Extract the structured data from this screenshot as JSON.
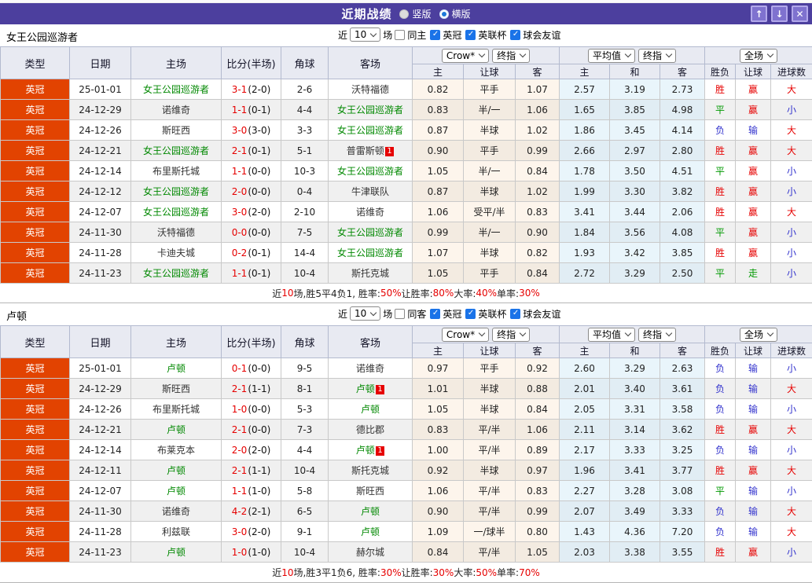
{
  "colors": {
    "titlebar_bg": "#4c3f9e",
    "league_cell_bg": "#e24301",
    "focus_team": "#008800",
    "score_red": "#e60000",
    "result_text": {
      "胜": "red",
      "平": "green",
      "负": "blue",
      "赢": "red",
      "输": "blue",
      "走": "green",
      "大": "red",
      "小": "blue"
    }
  },
  "title_bar": {
    "title": "近期战绩",
    "radio_vertical": "竖版",
    "radio_horizontal": "横版",
    "selected_layout": "横版",
    "buttons": {
      "up": "↑",
      "down": "↓",
      "close": "✕"
    }
  },
  "columns": {
    "main": [
      "类型",
      "日期",
      "主场",
      "比分(半场)",
      "角球",
      "客场"
    ],
    "sub": [
      "主",
      "让球",
      "客",
      "主",
      "和",
      "客",
      "胜负",
      "让球",
      "进球数"
    ]
  },
  "sections": [
    {
      "team": "女王公园巡游者",
      "filter": {
        "near": "近",
        "count": "10",
        "matches": "场",
        "same_label": "同主",
        "same_checked": false,
        "leagues": [
          {
            "label": "英冠",
            "checked": true
          },
          {
            "label": "英联杯",
            "checked": true
          },
          {
            "label": "球会友谊",
            "checked": true
          }
        ]
      },
      "dropdowns": {
        "odds_company": "Crow*",
        "odds_final": "终指",
        "avg": "平均值",
        "avg_final": "终指",
        "scope": "全场"
      },
      "rows": [
        {
          "league": "英冠",
          "date": "25-01-01",
          "home": "女王公园巡游者",
          "home_focus": true,
          "home_red": false,
          "score_ft": "3-1",
          "score_half": "(2-0)",
          "corner": "2-6",
          "away": "沃特福德",
          "away_focus": false,
          "away_red": false,
          "odds_home": "0.82",
          "handicap": "平手",
          "odds_away": "1.07",
          "avg_home": "2.57",
          "avg_draw": "3.19",
          "avg_away": "2.73",
          "result": "胜",
          "handicap_result": "赢",
          "goals": "大"
        },
        {
          "league": "英冠",
          "date": "24-12-29",
          "home": "诺维奇",
          "home_focus": false,
          "home_red": false,
          "score_ft": "1-1",
          "score_half": "(0-1)",
          "corner": "4-4",
          "away": "女王公园巡游者",
          "away_focus": true,
          "away_red": false,
          "odds_home": "0.83",
          "handicap": "半/一",
          "odds_away": "1.06",
          "avg_home": "1.65",
          "avg_draw": "3.85",
          "avg_away": "4.98",
          "result": "平",
          "handicap_result": "赢",
          "goals": "小"
        },
        {
          "league": "英冠",
          "date": "24-12-26",
          "home": "斯旺西",
          "home_focus": false,
          "home_red": false,
          "score_ft": "3-0",
          "score_half": "(3-0)",
          "corner": "3-3",
          "away": "女王公园巡游者",
          "away_focus": true,
          "away_red": false,
          "odds_home": "0.87",
          "handicap": "半球",
          "odds_away": "1.02",
          "avg_home": "1.86",
          "avg_draw": "3.45",
          "avg_away": "4.14",
          "result": "负",
          "handicap_result": "输",
          "goals": "大"
        },
        {
          "league": "英冠",
          "date": "24-12-21",
          "home": "女王公园巡游者",
          "home_focus": true,
          "home_red": false,
          "score_ft": "2-1",
          "score_half": "(0-1)",
          "corner": "5-1",
          "away": "普雷斯顿",
          "away_focus": false,
          "away_red": true,
          "odds_home": "0.90",
          "handicap": "平手",
          "odds_away": "0.99",
          "avg_home": "2.66",
          "avg_draw": "2.97",
          "avg_away": "2.80",
          "result": "胜",
          "handicap_result": "赢",
          "goals": "大"
        },
        {
          "league": "英冠",
          "date": "24-12-14",
          "home": "布里斯托城",
          "home_focus": false,
          "home_red": false,
          "score_ft": "1-1",
          "score_half": "(0-0)",
          "corner": "10-3",
          "away": "女王公园巡游者",
          "away_focus": true,
          "away_red": false,
          "odds_home": "1.05",
          "handicap": "半/一",
          "odds_away": "0.84",
          "avg_home": "1.78",
          "avg_draw": "3.50",
          "avg_away": "4.51",
          "result": "平",
          "handicap_result": "赢",
          "goals": "小"
        },
        {
          "league": "英冠",
          "date": "24-12-12",
          "home": "女王公园巡游者",
          "home_focus": true,
          "home_red": false,
          "score_ft": "2-0",
          "score_half": "(0-0)",
          "corner": "0-4",
          "away": "牛津联队",
          "away_focus": false,
          "away_red": false,
          "odds_home": "0.87",
          "handicap": "半球",
          "odds_away": "1.02",
          "avg_home": "1.99",
          "avg_draw": "3.30",
          "avg_away": "3.82",
          "result": "胜",
          "handicap_result": "赢",
          "goals": "小"
        },
        {
          "league": "英冠",
          "date": "24-12-07",
          "home": "女王公园巡游者",
          "home_focus": true,
          "home_red": false,
          "score_ft": "3-0",
          "score_half": "(2-0)",
          "corner": "2-10",
          "away": "诺维奇",
          "away_focus": false,
          "away_red": false,
          "odds_home": "1.06",
          "handicap": "受平/半",
          "odds_away": "0.83",
          "avg_home": "3.41",
          "avg_draw": "3.44",
          "avg_away": "2.06",
          "result": "胜",
          "handicap_result": "赢",
          "goals": "大"
        },
        {
          "league": "英冠",
          "date": "24-11-30",
          "home": "沃特福德",
          "home_focus": false,
          "home_red": false,
          "score_ft": "0-0",
          "score_half": "(0-0)",
          "corner": "7-5",
          "away": "女王公园巡游者",
          "away_focus": true,
          "away_red": false,
          "odds_home": "0.99",
          "handicap": "半/一",
          "odds_away": "0.90",
          "avg_home": "1.84",
          "avg_draw": "3.56",
          "avg_away": "4.08",
          "result": "平",
          "handicap_result": "赢",
          "goals": "小"
        },
        {
          "league": "英冠",
          "date": "24-11-28",
          "home": "卡迪夫城",
          "home_focus": false,
          "home_red": false,
          "score_ft": "0-2",
          "score_half": "(0-1)",
          "corner": "14-4",
          "away": "女王公园巡游者",
          "away_focus": true,
          "away_red": false,
          "odds_home": "1.07",
          "handicap": "半球",
          "odds_away": "0.82",
          "avg_home": "1.93",
          "avg_draw": "3.42",
          "avg_away": "3.85",
          "result": "胜",
          "handicap_result": "赢",
          "goals": "小"
        },
        {
          "league": "英冠",
          "date": "24-11-23",
          "home": "女王公园巡游者",
          "home_focus": true,
          "home_red": false,
          "score_ft": "1-1",
          "score_half": "(0-1)",
          "corner": "10-4",
          "away": "斯托克城",
          "away_focus": false,
          "away_red": false,
          "odds_home": "1.05",
          "handicap": "平手",
          "odds_away": "0.84",
          "avg_home": "2.72",
          "avg_draw": "3.29",
          "avg_away": "2.50",
          "result": "平",
          "handicap_result": "走",
          "goals": "小"
        }
      ],
      "summary": [
        {
          "text": "近",
          "hl": false
        },
        {
          "text": "10",
          "hl": true
        },
        {
          "text": "场,胜5平4负1, 胜率:",
          "hl": false
        },
        {
          "text": "50%",
          "hl": true
        },
        {
          "text": " 让胜率:",
          "hl": false
        },
        {
          "text": "80%",
          "hl": true
        },
        {
          "text": " 大率:",
          "hl": false
        },
        {
          "text": "40%",
          "hl": true
        },
        {
          "text": " 单率:",
          "hl": false
        },
        {
          "text": "30%",
          "hl": true
        }
      ]
    },
    {
      "team": "卢顿",
      "filter": {
        "near": "近",
        "count": "10",
        "matches": "场",
        "same_label": "同客",
        "same_checked": false,
        "leagues": [
          {
            "label": "英冠",
            "checked": true
          },
          {
            "label": "英联杯",
            "checked": true
          },
          {
            "label": "球会友谊",
            "checked": true
          }
        ]
      },
      "dropdowns": {
        "odds_company": "Crow*",
        "odds_final": "终指",
        "avg": "平均值",
        "avg_final": "终指",
        "scope": "全场"
      },
      "rows": [
        {
          "league": "英冠",
          "date": "25-01-01",
          "home": "卢顿",
          "home_focus": true,
          "home_red": false,
          "score_ft": "0-1",
          "score_half": "(0-0)",
          "corner": "9-5",
          "away": "诺维奇",
          "away_focus": false,
          "away_red": false,
          "odds_home": "0.97",
          "handicap": "平手",
          "odds_away": "0.92",
          "avg_home": "2.60",
          "avg_draw": "3.29",
          "avg_away": "2.63",
          "result": "负",
          "handicap_result": "输",
          "goals": "小"
        },
        {
          "league": "英冠",
          "date": "24-12-29",
          "home": "斯旺西",
          "home_focus": false,
          "home_red": false,
          "score_ft": "2-1",
          "score_half": "(1-1)",
          "corner": "8-1",
          "away": "卢顿",
          "away_focus": true,
          "away_red": true,
          "odds_home": "1.01",
          "handicap": "半球",
          "odds_away": "0.88",
          "avg_home": "2.01",
          "avg_draw": "3.40",
          "avg_away": "3.61",
          "result": "负",
          "handicap_result": "输",
          "goals": "大"
        },
        {
          "league": "英冠",
          "date": "24-12-26",
          "home": "布里斯托城",
          "home_focus": false,
          "home_red": false,
          "score_ft": "1-0",
          "score_half": "(0-0)",
          "corner": "5-3",
          "away": "卢顿",
          "away_focus": true,
          "away_red": false,
          "odds_home": "1.05",
          "handicap": "半球",
          "odds_away": "0.84",
          "avg_home": "2.05",
          "avg_draw": "3.31",
          "avg_away": "3.58",
          "result": "负",
          "handicap_result": "输",
          "goals": "小"
        },
        {
          "league": "英冠",
          "date": "24-12-21",
          "home": "卢顿",
          "home_focus": true,
          "home_red": false,
          "score_ft": "2-1",
          "score_half": "(0-0)",
          "corner": "7-3",
          "away": "德比郡",
          "away_focus": false,
          "away_red": false,
          "odds_home": "0.83",
          "handicap": "平/半",
          "odds_away": "1.06",
          "avg_home": "2.11",
          "avg_draw": "3.14",
          "avg_away": "3.62",
          "result": "胜",
          "handicap_result": "赢",
          "goals": "大"
        },
        {
          "league": "英冠",
          "date": "24-12-14",
          "home": "布莱克本",
          "home_focus": false,
          "home_red": false,
          "score_ft": "2-0",
          "score_half": "(2-0)",
          "corner": "4-4",
          "away": "卢顿",
          "away_focus": true,
          "away_red": true,
          "odds_home": "1.00",
          "handicap": "平/半",
          "odds_away": "0.89",
          "avg_home": "2.17",
          "avg_draw": "3.33",
          "avg_away": "3.25",
          "result": "负",
          "handicap_result": "输",
          "goals": "小"
        },
        {
          "league": "英冠",
          "date": "24-12-11",
          "home": "卢顿",
          "home_focus": true,
          "home_red": false,
          "score_ft": "2-1",
          "score_half": "(1-1)",
          "corner": "10-4",
          "away": "斯托克城",
          "away_focus": false,
          "away_red": false,
          "odds_home": "0.92",
          "handicap": "半球",
          "odds_away": "0.97",
          "avg_home": "1.96",
          "avg_draw": "3.41",
          "avg_away": "3.77",
          "result": "胜",
          "handicap_result": "赢",
          "goals": "大"
        },
        {
          "league": "英冠",
          "date": "24-12-07",
          "home": "卢顿",
          "home_focus": true,
          "home_red": false,
          "score_ft": "1-1",
          "score_half": "(1-0)",
          "corner": "5-8",
          "away": "斯旺西",
          "away_focus": false,
          "away_red": false,
          "odds_home": "1.06",
          "handicap": "平/半",
          "odds_away": "0.83",
          "avg_home": "2.27",
          "avg_draw": "3.28",
          "avg_away": "3.08",
          "result": "平",
          "handicap_result": "输",
          "goals": "小"
        },
        {
          "league": "英冠",
          "date": "24-11-30",
          "home": "诺维奇",
          "home_focus": false,
          "home_red": false,
          "score_ft": "4-2",
          "score_half": "(2-1)",
          "corner": "6-5",
          "away": "卢顿",
          "away_focus": true,
          "away_red": false,
          "odds_home": "0.90",
          "handicap": "平/半",
          "odds_away": "0.99",
          "avg_home": "2.07",
          "avg_draw": "3.49",
          "avg_away": "3.33",
          "result": "负",
          "handicap_result": "输",
          "goals": "大"
        },
        {
          "league": "英冠",
          "date": "24-11-28",
          "home": "利兹联",
          "home_focus": false,
          "home_red": false,
          "score_ft": "3-0",
          "score_half": "(2-0)",
          "corner": "9-1",
          "away": "卢顿",
          "away_focus": true,
          "away_red": false,
          "odds_home": "1.09",
          "handicap": "一/球半",
          "odds_away": "0.80",
          "avg_home": "1.43",
          "avg_draw": "4.36",
          "avg_away": "7.20",
          "result": "负",
          "handicap_result": "输",
          "goals": "大"
        },
        {
          "league": "英冠",
          "date": "24-11-23",
          "home": "卢顿",
          "home_focus": true,
          "home_red": false,
          "score_ft": "1-0",
          "score_half": "(1-0)",
          "corner": "10-4",
          "away": "赫尔城",
          "away_focus": false,
          "away_red": false,
          "odds_home": "0.84",
          "handicap": "平/半",
          "odds_away": "1.05",
          "avg_home": "2.03",
          "avg_draw": "3.38",
          "avg_away": "3.55",
          "result": "胜",
          "handicap_result": "赢",
          "goals": "小"
        }
      ],
      "summary": [
        {
          "text": "近",
          "hl": false
        },
        {
          "text": "10",
          "hl": true
        },
        {
          "text": "场,胜3平1负6, 胜率:",
          "hl": false
        },
        {
          "text": "30%",
          "hl": true
        },
        {
          "text": " 让胜率:",
          "hl": false
        },
        {
          "text": "30%",
          "hl": true
        },
        {
          "text": " 大率:",
          "hl": false
        },
        {
          "text": "50%",
          "hl": true
        },
        {
          "text": " 单率:",
          "hl": false
        },
        {
          "text": "70%",
          "hl": true
        }
      ]
    }
  ]
}
